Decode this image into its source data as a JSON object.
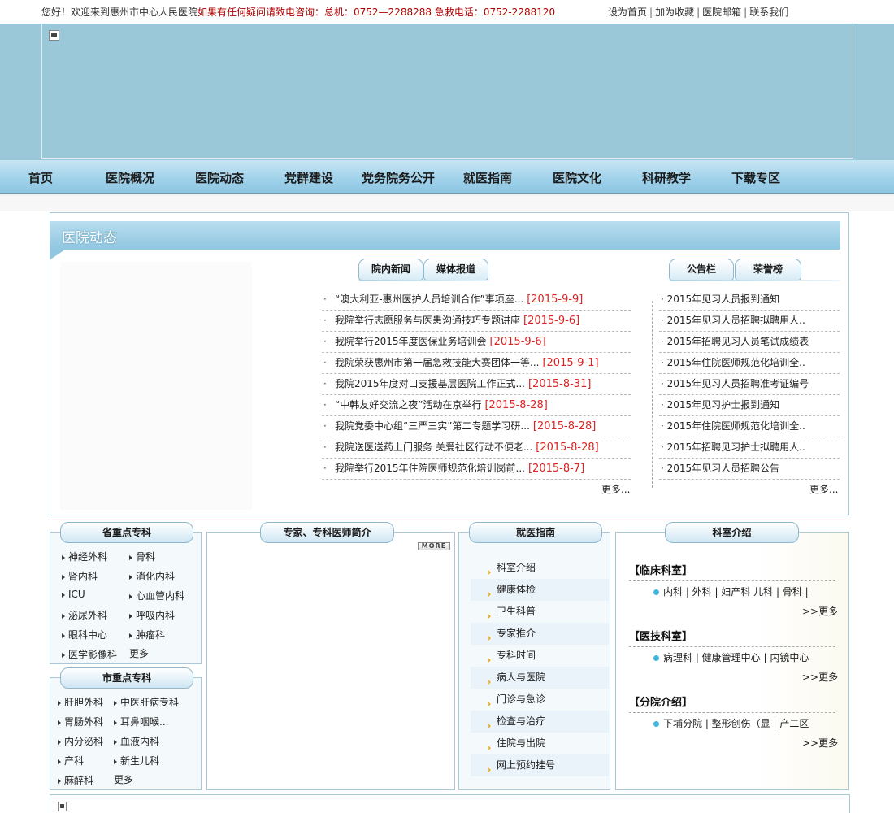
{
  "topbar": {
    "welcome": "您好！欢迎来到惠州市中心人民医院",
    "hotline": "如果有任何疑问请致电咨询：总机：0752—2288288 急救电话：0752-2288120",
    "links": [
      "设为首页",
      "加为收藏",
      "医院邮箱",
      "联系我们"
    ]
  },
  "nav": [
    "首页",
    "医院概况",
    "医院动态",
    "党群建设",
    "党务院务公开",
    "就医指南",
    "医院文化",
    "科研教学",
    "下载专区"
  ],
  "news_section": {
    "title": "医院动态",
    "tabs_left": [
      "院内新闻",
      "媒体报道"
    ],
    "tabs_right": [
      "公告栏",
      "荣誉榜"
    ],
    "news": [
      {
        "title": "“澳大利亚-惠州医护人员培训合作”事项座...",
        "date": "[2015-9-9]"
      },
      {
        "title": "我院举行志愿服务与医患沟通技巧专题讲座",
        "date": "[2015-9-6]"
      },
      {
        "title": "我院举行2015年度医保业务培训会",
        "date": "[2015-9-6]"
      },
      {
        "title": "我院荣获惠州市第一届急救技能大赛团体一等...",
        "date": "[2015-9-1]"
      },
      {
        "title": "我院2015年度对口支援基层医院工作正式...",
        "date": "[2015-8-31]"
      },
      {
        "title": "“中韩友好交流之夜”活动在京举行",
        "date": "[2015-8-28]"
      },
      {
        "title": "我院党委中心组“三严三实”第二专题学习研...",
        "date": "[2015-8-28]"
      },
      {
        "title": "我院送医送药上门服务 关爱社区行动不便老...",
        "date": "[2015-8-28]"
      },
      {
        "title": "我院举行2015年住院医师规范化培训岗前...",
        "date": "[2015-8-7]"
      }
    ],
    "news_more": "更多...",
    "notices": [
      "· 2015年见习人员报到通知",
      "· 2015年见习人员招聘拟聘用人..",
      "· 2015年招聘见习人员笔试成绩表",
      "· 2015年住院医师规范化培训全..",
      "· 2015年见习人员招聘准考证编号",
      "· 2015年见习护士报到通知",
      "· 2015年住院医师规范化培训全..",
      "· 2015年招聘见习护士拟聘用人..",
      "· 2015年见习人员招聘公告"
    ],
    "notices_more": "更多..."
  },
  "provincial": {
    "title": "省重点专科",
    "items": [
      "神经外科",
      "骨科",
      "肾内科",
      "消化内科",
      "ICU",
      "心血管内科",
      "泌尿外科",
      "呼吸内科",
      "眼科中心",
      "肿瘤科",
      "医学影像科"
    ],
    "more": "更多"
  },
  "municipal": {
    "title": "市重点专科",
    "items": [
      "肝胆外科",
      "中医肝病专科",
      "胃肠外科",
      "耳鼻咽喉...",
      "内分泌科",
      "血液内科",
      "产科",
      "新生儿科",
      "麻醉科"
    ],
    "more": "更多"
  },
  "experts": {
    "title": "专家、专科医师简介",
    "more_badge": "MORE"
  },
  "guide": {
    "title": "就医指南",
    "items": [
      "科室介绍",
      "健康体检",
      "卫生科普",
      "专家推介",
      "专科时间",
      "病人与医院",
      "门诊与急诊",
      "检查与治疗",
      "住院与出院",
      "网上预约挂号"
    ]
  },
  "departments": {
    "title": "科室介绍",
    "groups": [
      {
        "heading": "【临床科室】",
        "items": "内科 | 外科 | 妇产科 儿科 | 骨科 |",
        "more": ">>更多"
      },
      {
        "heading": "【医技科室】",
        "items": "病理科 | 健康管理中心 | 内镜中心",
        "more": ">>更多"
      },
      {
        "heading": "【分院介绍】",
        "items": "下埔分院 | 整形创伤（显 | 产二区",
        "more": ">>更多"
      }
    ]
  },
  "colors": {
    "banner": "#9ac8d9",
    "hotline": "#b00000",
    "date": "#dd2222",
    "accent": "#3fb6e0"
  }
}
